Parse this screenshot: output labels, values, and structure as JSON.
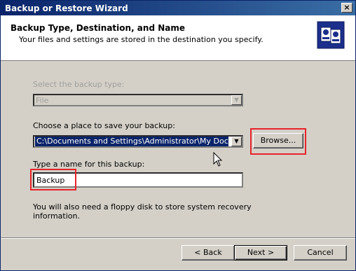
{
  "window": {
    "title": "Backup or Restore Wizard",
    "close_label": "×"
  },
  "header": {
    "title": "Backup Type, Destination, and Name",
    "subtitle": "Your files and settings are stored in the destination you specify."
  },
  "form": {
    "backup_type_label": "Select the backup type:",
    "backup_type_value": "File",
    "place_label": "Choose a place to save your backup:",
    "place_value": "C:\\Documents and Settings\\Administrator\\My Documents\\",
    "browse_label": "Browse...",
    "name_label": "Type a name for this backup:",
    "name_value": "Backup",
    "info_text_line1": "You will also need a floppy disk to store system recovery",
    "info_text_line2": "information."
  },
  "footer": {
    "back_label": "< Back",
    "next_label": "Next >",
    "cancel_label": "Cancel"
  },
  "colors": {
    "titlebar_start": "#0a246a",
    "highlight_box": "#e8232a",
    "dialog_bg": "#d4d0c8"
  }
}
